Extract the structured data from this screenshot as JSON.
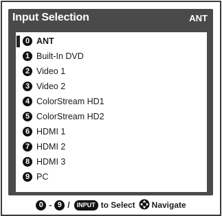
{
  "menu": {
    "title": "Input Selection",
    "current_input": "ANT"
  },
  "inputs": [
    {
      "number": "0",
      "label": "ANT",
      "selected": true
    },
    {
      "number": "1",
      "label": "Built-In DVD"
    },
    {
      "number": "2",
      "label": "Video 1"
    },
    {
      "number": "3",
      "label": "Video 2"
    },
    {
      "number": "4",
      "label": "ColorStream HD1"
    },
    {
      "number": "5",
      "label": "ColorStream HD2"
    },
    {
      "number": "6",
      "label": "HDMI 1"
    },
    {
      "number": "7",
      "label": "HDMI 2"
    },
    {
      "number": "8",
      "label": "HDMI 3"
    },
    {
      "number": "9",
      "label": "PC"
    }
  ],
  "footer": {
    "range_start": "0",
    "dash": "-",
    "range_end": "9",
    "slash": "/",
    "input_button": "INPUT",
    "select_text": "to Select",
    "navigate_text": "Navigate"
  },
  "icons": {
    "navigate": "dpad-icon"
  },
  "colors": {
    "panel": "#4a4a4a",
    "title_text": "#ffffff",
    "icon_fill": "#111111"
  }
}
